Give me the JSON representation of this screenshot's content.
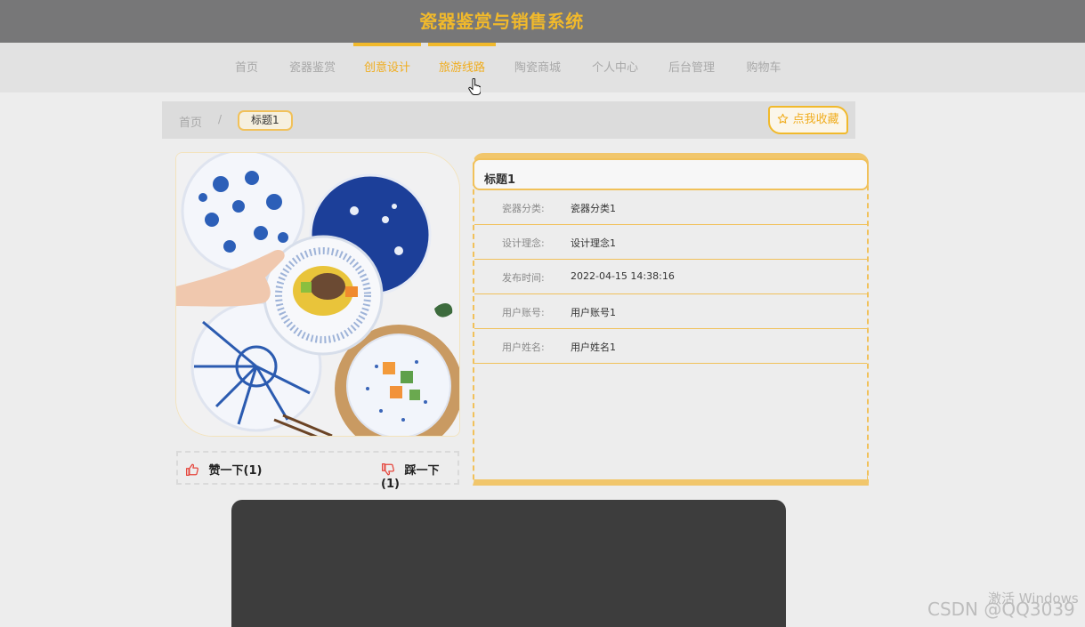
{
  "header": {
    "title": "瓷器鉴赏与销售系统"
  },
  "nav": {
    "items": [
      {
        "label": "首页"
      },
      {
        "label": "瓷器鉴赏"
      },
      {
        "label": "创意设计"
      },
      {
        "label": "旅游线路"
      },
      {
        "label": "陶瓷商城"
      },
      {
        "label": "个人中心"
      },
      {
        "label": "后台管理"
      },
      {
        "label": "购物车"
      }
    ]
  },
  "breadcrumb": {
    "home": "首页",
    "separator": "/",
    "current": "标题1"
  },
  "favorite": {
    "label": "点我收藏",
    "icon": "star-outline-icon"
  },
  "detail": {
    "title": "标题1",
    "fields": [
      {
        "label": "瓷器分类:",
        "value": "瓷器分类1"
      },
      {
        "label": "设计理念:",
        "value": "设计理念1"
      },
      {
        "label": "发布时间:",
        "value": "2022-04-15 14:38:16"
      },
      {
        "label": "用户账号:",
        "value": "用户账号1"
      },
      {
        "label": "用户姓名:",
        "value": "用户姓名1"
      }
    ]
  },
  "votes": {
    "like_label": "赞一下(1)",
    "dislike_label": "踩一下(1)"
  },
  "overlay": {
    "windows_activation": "激活 Windows",
    "watermark": "CSDN @QQ3039"
  },
  "colors": {
    "accent": "#f1b92b",
    "header_bg": "#777778",
    "nav_bg": "#e2e2e2",
    "like_red": "#e5463d"
  }
}
